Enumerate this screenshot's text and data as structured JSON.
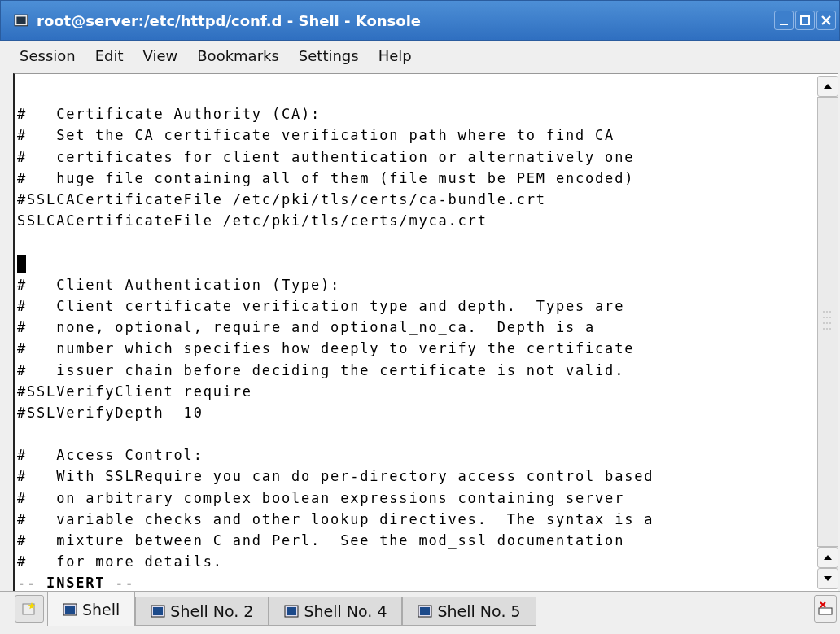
{
  "window": {
    "title": "root@server:/etc/httpd/conf.d - Shell - Konsole"
  },
  "menu": [
    "Session",
    "Edit",
    "View",
    "Bookmarks",
    "Settings",
    "Help"
  ],
  "terminal": {
    "lines": [
      {
        "kind": "blank"
      },
      {
        "kind": "text",
        "text": "#   Certificate Authority (CA):"
      },
      {
        "kind": "text",
        "text": "#   Set the CA certificate verification path where to find CA"
      },
      {
        "kind": "text",
        "text": "#   certificates for client authentication or alternatively one"
      },
      {
        "kind": "text",
        "text": "#   huge file containing all of them (file must be PEM encoded)"
      },
      {
        "kind": "text",
        "text": "#SSLCACertificateFile /etc/pki/tls/certs/ca-bundle.crt"
      },
      {
        "kind": "text",
        "text": "SSLCACertificateFile /etc/pki/tls/certs/myca.crt"
      },
      {
        "kind": "blank"
      },
      {
        "kind": "cursor"
      },
      {
        "kind": "text",
        "text": "#   Client Authentication (Type):"
      },
      {
        "kind": "text",
        "text": "#   Client certificate verification type and depth.  Types are"
      },
      {
        "kind": "text",
        "text": "#   none, optional, require and optional_no_ca.  Depth is a"
      },
      {
        "kind": "text",
        "text": "#   number which specifies how deeply to verify the certificate"
      },
      {
        "kind": "text",
        "text": "#   issuer chain before deciding the certificate is not valid."
      },
      {
        "kind": "text",
        "text": "#SSLVerifyClient require"
      },
      {
        "kind": "text",
        "text": "#SSLVerifyDepth  10"
      },
      {
        "kind": "blank"
      },
      {
        "kind": "text",
        "text": "#   Access Control:"
      },
      {
        "kind": "text",
        "text": "#   With SSLRequire you can do per-directory access control based"
      },
      {
        "kind": "text",
        "text": "#   on arbitrary complex boolean expressions containing server"
      },
      {
        "kind": "text",
        "text": "#   variable checks and other lookup directives.  The syntax is a"
      },
      {
        "kind": "text",
        "text": "#   mixture between C and Perl.  See the mod_ssl documentation"
      },
      {
        "kind": "text",
        "text": "#   for more details."
      },
      {
        "kind": "text",
        "text": "-- **INSERT** --"
      }
    ]
  },
  "tabs": [
    {
      "label": "Shell",
      "selected": true
    },
    {
      "label": "Shell No. 2",
      "selected": false
    },
    {
      "label": "Shell No. 4",
      "selected": false
    },
    {
      "label": "Shell No. 5",
      "selected": false
    }
  ]
}
